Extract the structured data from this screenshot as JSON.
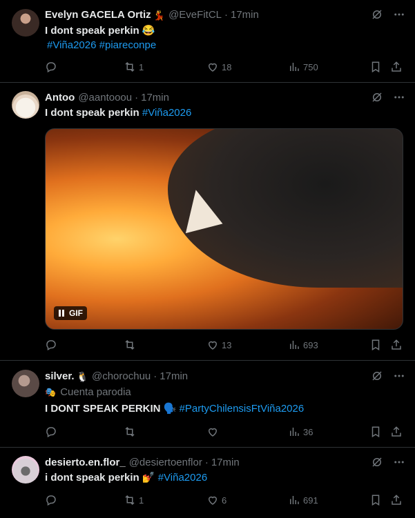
{
  "posts": [
    {
      "name": "Evelyn GACELA Ortiz",
      "name_emoji": "💃",
      "handle": "@EveFitCL",
      "time": "17min",
      "text": "I dont speak perkin 😂",
      "hashtags": "#Viña2026 #piareconpe",
      "replies": "",
      "reposts": "1",
      "likes": "18",
      "views": "750",
      "avatar_color": "#6b4a3c"
    },
    {
      "name": "Antoo",
      "name_emoji": "",
      "handle": "@aantooou",
      "time": "17min",
      "text": "I dont speak perkin",
      "hashtags": "#Viña2026",
      "media_badge": "GIF",
      "replies": "",
      "reposts": "",
      "likes": "13",
      "views": "693",
      "avatar_color": "#f4efe6"
    },
    {
      "name": "silver.",
      "name_emoji": "🐧",
      "handle": "@chorochuu",
      "time": "17min",
      "parody_label": "Cuenta parodia",
      "text": "I DONT SPEAK PERKIN 🗣️",
      "hashtags": "#PartyChilensisFtViña2026",
      "replies": "",
      "reposts": "",
      "likes": "",
      "views": "36",
      "avatar_color": "#8c7a74"
    },
    {
      "name": "desierto.en.flor_",
      "name_emoji": "",
      "handle": "@desiertoenflor",
      "time": "17min",
      "text": "i dont speak perkin 💅",
      "hashtags": "#Viña2026",
      "replies": "",
      "reposts": "1",
      "likes": "6",
      "views": "691",
      "avatar_color": "#d8cfd6"
    }
  ],
  "colors": {
    "accent": "#1d9bf0",
    "muted": "#71767b",
    "text": "#e7e9ea",
    "border": "#2f3336"
  },
  "icons": [
    "grok-icon",
    "more-icon",
    "reply-icon",
    "repost-icon",
    "like-icon",
    "views-icon",
    "bookmark-icon",
    "share-icon",
    "parody-mask-icon",
    "pause-icon"
  ]
}
